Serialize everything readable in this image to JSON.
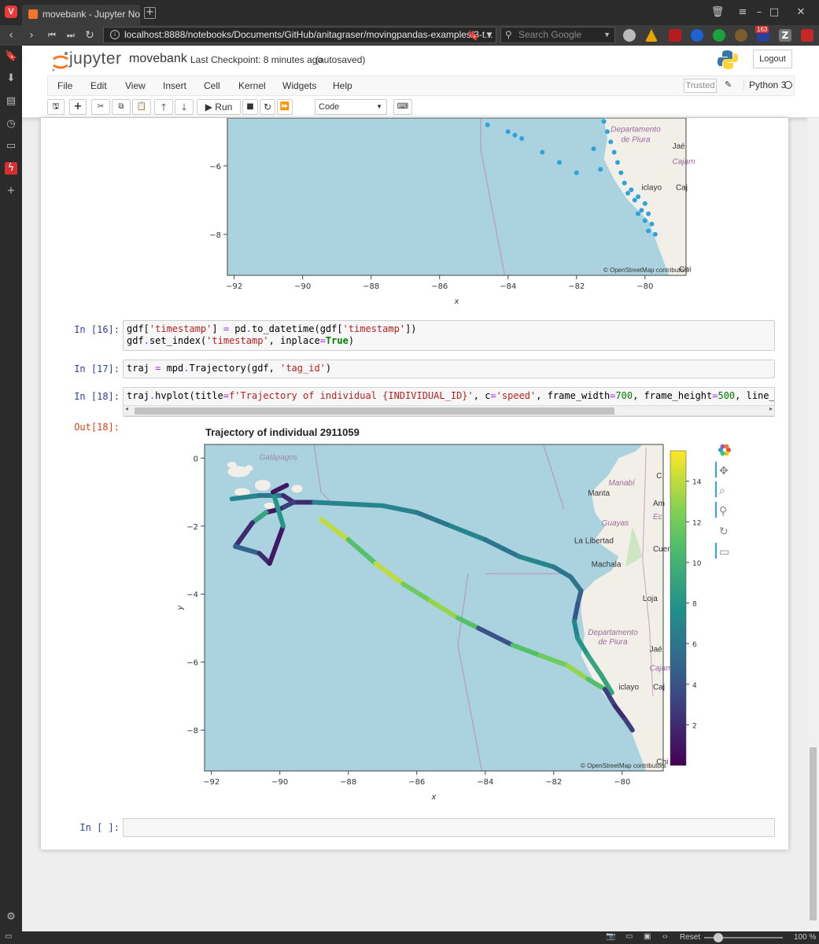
{
  "browser": {
    "tab_title": "movebank - Jupyter Noteb",
    "url": "localhost:8888/notebooks/Documents/GitHub/anitagraser/movingpandas-examples/3-t...",
    "search_placeholder": "Search Google",
    "badge_count": "163",
    "zoom": "100 %",
    "reset_label": "Reset"
  },
  "jupyter": {
    "logo_text": "jupyter",
    "notebook_name": "movebank",
    "checkpoint": "Last Checkpoint: 8 minutes ago",
    "autosave": "(autosaved)",
    "logout_label": "Logout",
    "menu": [
      "File",
      "Edit",
      "View",
      "Insert",
      "Cell",
      "Kernel",
      "Widgets",
      "Help"
    ],
    "trusted_label": "Trusted",
    "kernel_name": "Python 3",
    "run_label": "Run",
    "cell_type": "Code"
  },
  "cells": {
    "in16_prompt": "In [16]:",
    "in17_prompt": "In [17]:",
    "in18_prompt": "In [18]:",
    "out18_prompt": "Out[18]:",
    "empty_prompt": "In [ ]:"
  },
  "top_plot": {
    "xlabel": "x",
    "x_ticks": [
      "−92",
      "−90",
      "−88",
      "−86",
      "−84",
      "−82",
      "−80"
    ],
    "y_ticks": [
      "−6",
      "−8"
    ],
    "attribution": "© OpenStreetMap contributors",
    "places": [
      "Departamento",
      "de Piura",
      "Jaé",
      "Cajam",
      "iclayo",
      "Caj",
      "Chi"
    ]
  },
  "chart_data": {
    "type": "line",
    "title": "Trajectory of individual 2911059",
    "xlabel": "x",
    "ylabel": "y",
    "xlim": [
      -92.2,
      -78.8
    ],
    "ylim": [
      -9.2,
      0.4
    ],
    "x_ticks": [
      "−92",
      "−90",
      "−88",
      "−86",
      "−84",
      "−82",
      "−80"
    ],
    "y_ticks": [
      "0",
      "−2",
      "−4",
      "−6",
      "−8"
    ],
    "colorbar": {
      "min": 0,
      "max": 15.5,
      "ticks": [
        "2",
        "4",
        "6",
        "8",
        "10",
        "12",
        "14"
      ]
    },
    "attribution": "© OpenStreetMap contributors",
    "places": [
      "Galápagos",
      "Manabí",
      "Manta",
      "Am",
      "Ec",
      "Guayas",
      "La Libertad",
      "Cuenc",
      "Machala",
      "Loja",
      "Departamento",
      "de Piura",
      "Jaé",
      "Cajam",
      "iclayo",
      "Caj",
      "Chi",
      "C"
    ],
    "track": [
      {
        "x": -88.8,
        "y": -1.8,
        "speed": 14
      },
      {
        "x": -88.0,
        "y": -2.4,
        "speed": 11
      },
      {
        "x": -87.2,
        "y": -3.1,
        "speed": 14
      },
      {
        "x": -86.4,
        "y": -3.7,
        "speed": 12
      },
      {
        "x": -85.6,
        "y": -4.2,
        "speed": 13
      },
      {
        "x": -84.8,
        "y": -4.7,
        "speed": 11
      },
      {
        "x": -84.2,
        "y": -5.0,
        "speed": 4
      },
      {
        "x": -83.2,
        "y": -5.5,
        "speed": 11
      },
      {
        "x": -82.4,
        "y": -5.8,
        "speed": 12
      },
      {
        "x": -81.6,
        "y": -6.1,
        "speed": 13
      },
      {
        "x": -81.0,
        "y": -6.5,
        "speed": 11
      },
      {
        "x": -80.5,
        "y": -6.8,
        "speed": 3
      },
      {
        "x": -80.2,
        "y": -7.3,
        "speed": 2
      },
      {
        "x": -79.9,
        "y": -7.7,
        "speed": 3
      },
      {
        "x": -79.7,
        "y": -8.0,
        "speed": 2
      }
    ],
    "track_north": [
      {
        "x": -89.6,
        "y": -1.3,
        "speed": 2
      },
      {
        "x": -89.0,
        "y": -1.3,
        "speed": 7
      },
      {
        "x": -88.0,
        "y": -1.35,
        "speed": 7
      },
      {
        "x": -87.0,
        "y": -1.4,
        "speed": 7
      },
      {
        "x": -86.0,
        "y": -1.6,
        "speed": 6
      },
      {
        "x": -85.0,
        "y": -2.0,
        "speed": 7
      },
      {
        "x": -84.0,
        "y": -2.4,
        "speed": 6
      },
      {
        "x": -83.0,
        "y": -2.9,
        "speed": 7
      },
      {
        "x": -82.0,
        "y": -3.2,
        "speed": 6
      },
      {
        "x": -81.5,
        "y": -3.5,
        "speed": 6
      },
      {
        "x": -81.2,
        "y": -3.9,
        "speed": 5
      },
      {
        "x": -81.3,
        "y": -4.3,
        "speed": 4
      },
      {
        "x": -81.4,
        "y": -4.8,
        "speed": 7
      },
      {
        "x": -81.3,
        "y": -5.3,
        "speed": 8
      },
      {
        "x": -81.0,
        "y": -5.8,
        "speed": 9
      },
      {
        "x": -80.6,
        "y": -6.4,
        "speed": 9
      },
      {
        "x": -80.3,
        "y": -6.9,
        "speed": 4
      }
    ],
    "track_galapagos": [
      {
        "x": -91.4,
        "y": -1.2,
        "speed": 7
      },
      {
        "x": -90.6,
        "y": -1.1,
        "speed": 6
      },
      {
        "x": -89.9,
        "y": -1.1,
        "speed": 2
      },
      {
        "x": -89.6,
        "y": -1.3,
        "speed": 3
      },
      {
        "x": -90.0,
        "y": -1.5,
        "speed": 1
      },
      {
        "x": -90.4,
        "y": -1.6,
        "speed": 9
      },
      {
        "x": -90.8,
        "y": -1.9,
        "speed": 2
      },
      {
        "x": -91.3,
        "y": -2.6,
        "speed": 5
      },
      {
        "x": -90.6,
        "y": -2.8,
        "speed": 2
      },
      {
        "x": -90.3,
        "y": -3.1,
        "speed": 1
      },
      {
        "x": -89.9,
        "y": -2.0,
        "speed": 8
      },
      {
        "x": -90.2,
        "y": -1.0,
        "speed": 1
      },
      {
        "x": -89.8,
        "y": -0.8,
        "speed": 2
      }
    ]
  }
}
